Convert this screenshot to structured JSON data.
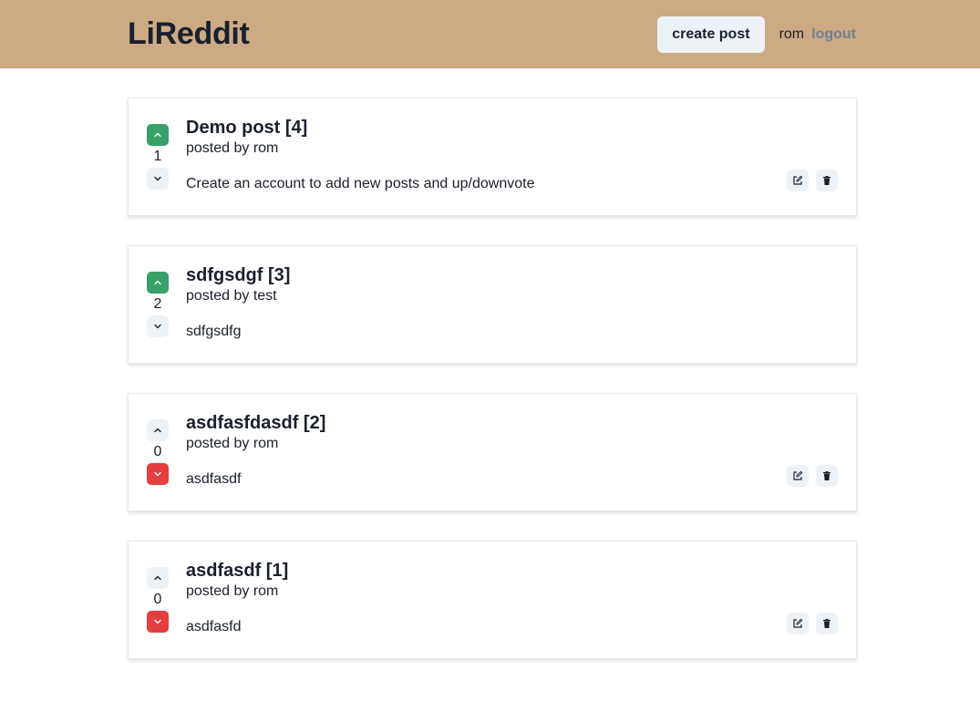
{
  "navbar": {
    "brand": "LiReddit",
    "create_label": "create post",
    "username": "rom",
    "logout_label": "logout"
  },
  "colors": {
    "navbar_bg": "#ccaa84",
    "upvote_active": "#38a169",
    "downvote_active": "#e53e3e",
    "button_bg": "#edf2f7"
  },
  "posts": [
    {
      "title": "Demo post [4]",
      "author": "posted by rom",
      "snippet": "Create an account to add new posts and up/downvote",
      "score": "1",
      "vote": "up",
      "owned": true
    },
    {
      "title": "sdfgsdgf [3]",
      "author": "posted by test",
      "snippet": "sdfgsdfg",
      "score": "2",
      "vote": "up",
      "owned": false
    },
    {
      "title": "asdfasfdasdf [2]",
      "author": "posted by rom",
      "snippet": "asdfasdf",
      "score": "0",
      "vote": "down",
      "owned": true
    },
    {
      "title": "asdfasdf [1]",
      "author": "posted by rom",
      "snippet": "asdfasfd",
      "score": "0",
      "vote": "down",
      "owned": true
    }
  ],
  "icons": {
    "upvote": "chevron-up-icon",
    "downvote": "chevron-down-icon",
    "edit": "edit-icon",
    "delete": "trash-icon"
  }
}
